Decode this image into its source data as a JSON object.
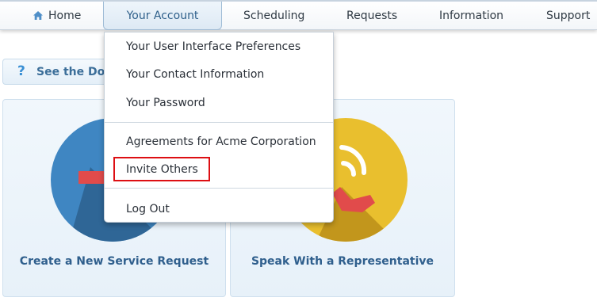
{
  "nav": {
    "items": [
      {
        "label": "Home",
        "icon": "home-icon"
      },
      {
        "label": "Your Account",
        "active": true
      },
      {
        "label": "Scheduling"
      },
      {
        "label": "Requests"
      },
      {
        "label": "Information"
      },
      {
        "label": "Support"
      }
    ]
  },
  "help": {
    "label": "See the Doc",
    "icon": "question-icon"
  },
  "cards": [
    {
      "label": "Create a New Service Request",
      "icon": "service-request-icon",
      "color": "#3f86c2"
    },
    {
      "label": "Speak With a Representative",
      "icon": "phone-icon",
      "color": "#e9bf2e"
    }
  ],
  "dropdown": {
    "items": [
      "Your User Interface Preferences",
      "Your Contact Information",
      "Your Password",
      "Agreements for Acme Corporation",
      "Invite Others",
      "Log Out"
    ],
    "highlighted": "Invite Others",
    "highlight_color": "#dd0f13"
  }
}
